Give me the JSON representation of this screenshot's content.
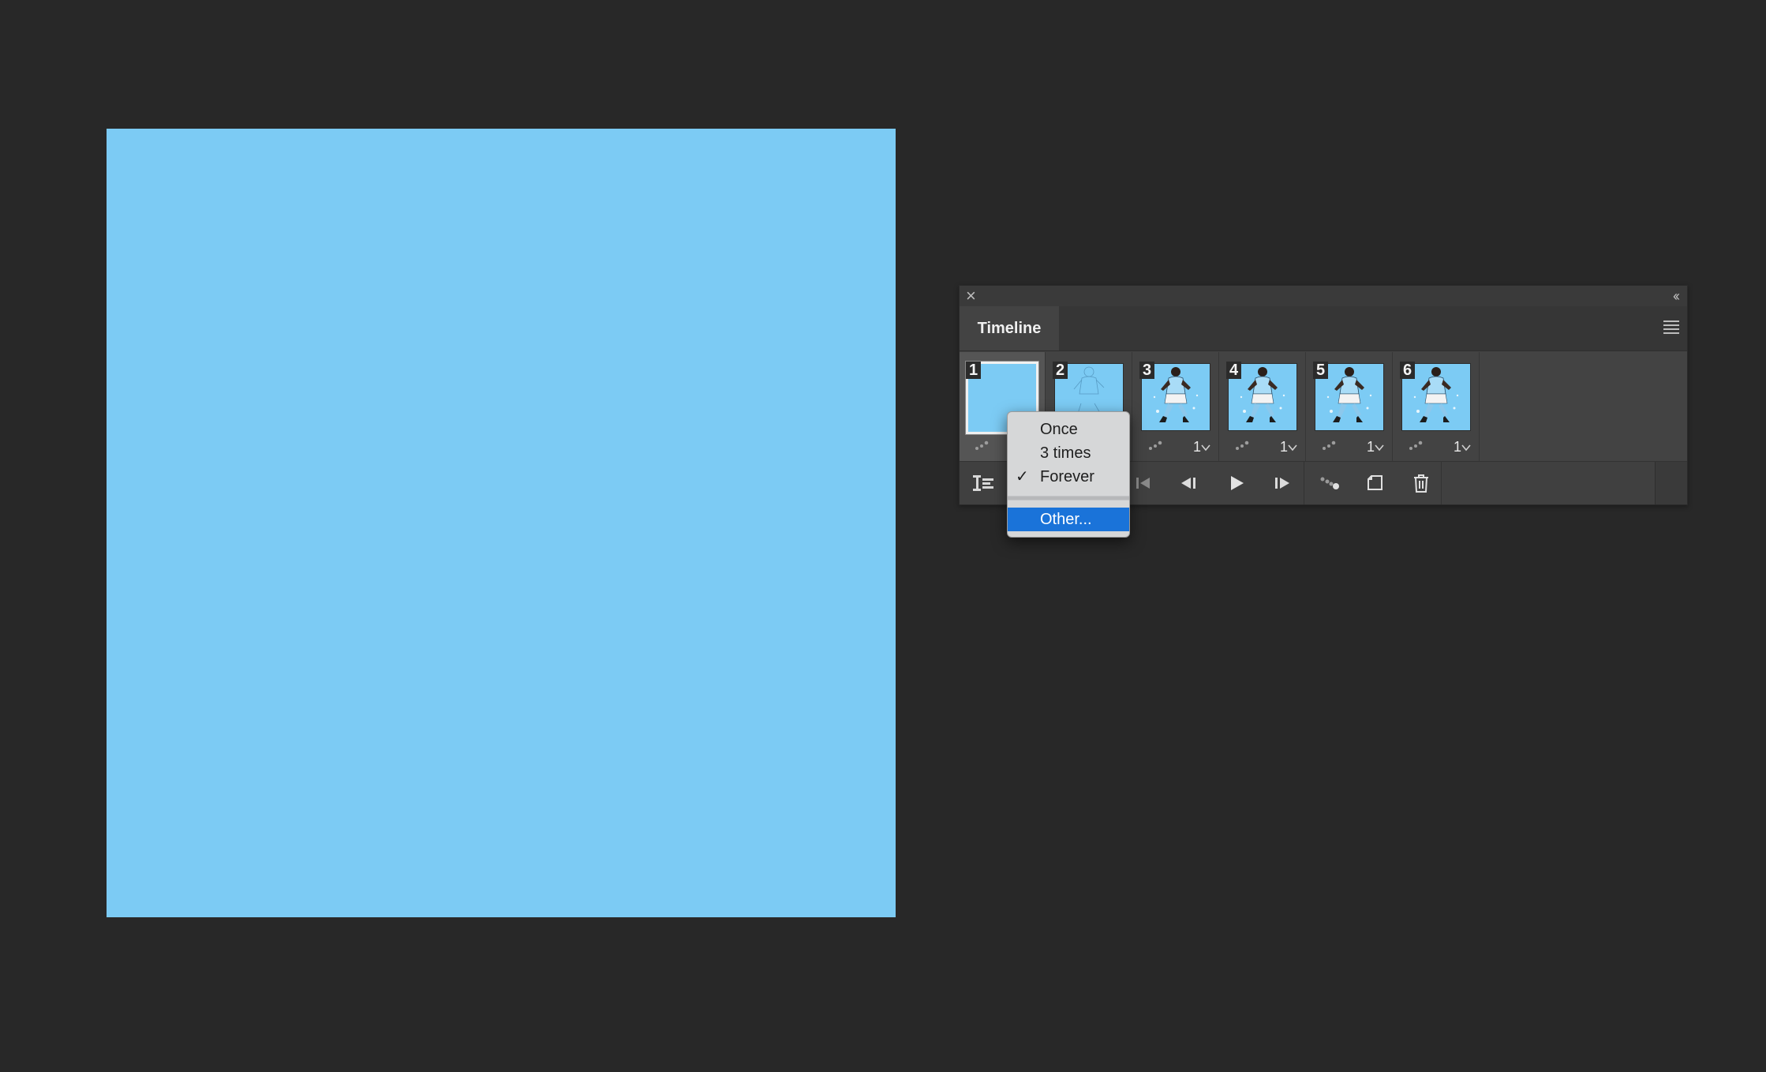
{
  "document": {
    "canvas_color": "#7ccbf4"
  },
  "timeline_panel": {
    "close_glyph": "×",
    "collapse_glyph": "‹‹",
    "tab_label": "Timeline",
    "frames": [
      {
        "number": "1",
        "delay": "",
        "selected": true,
        "thumb": "blank"
      },
      {
        "number": "2",
        "delay": "",
        "selected": false,
        "thumb": "sketch"
      },
      {
        "number": "3",
        "delay": "1",
        "selected": false,
        "thumb": "player"
      },
      {
        "number": "4",
        "delay": "1",
        "selected": false,
        "thumb": "player"
      },
      {
        "number": "5",
        "delay": "1",
        "selected": false,
        "thumb": "player"
      },
      {
        "number": "6",
        "delay": "1",
        "selected": false,
        "thumb": "player"
      }
    ],
    "toolbar_icons": [
      "convert-to-video-timeline-icon",
      "select-first-frame-icon",
      "previous-frame-icon",
      "play-icon",
      "next-frame-icon",
      "tween-icon",
      "duplicate-frame-icon",
      "delete-frame-icon"
    ]
  },
  "loop_menu": {
    "items": [
      {
        "label": "Once",
        "checked": false,
        "highlighted": false
      },
      {
        "label": "3 times",
        "checked": false,
        "highlighted": false
      },
      {
        "label": "Forever",
        "checked": true,
        "highlighted": false
      },
      {
        "label": "Other...",
        "checked": false,
        "highlighted": true
      }
    ],
    "check_glyph": "✓",
    "highlight_color": "#1a73d9"
  }
}
